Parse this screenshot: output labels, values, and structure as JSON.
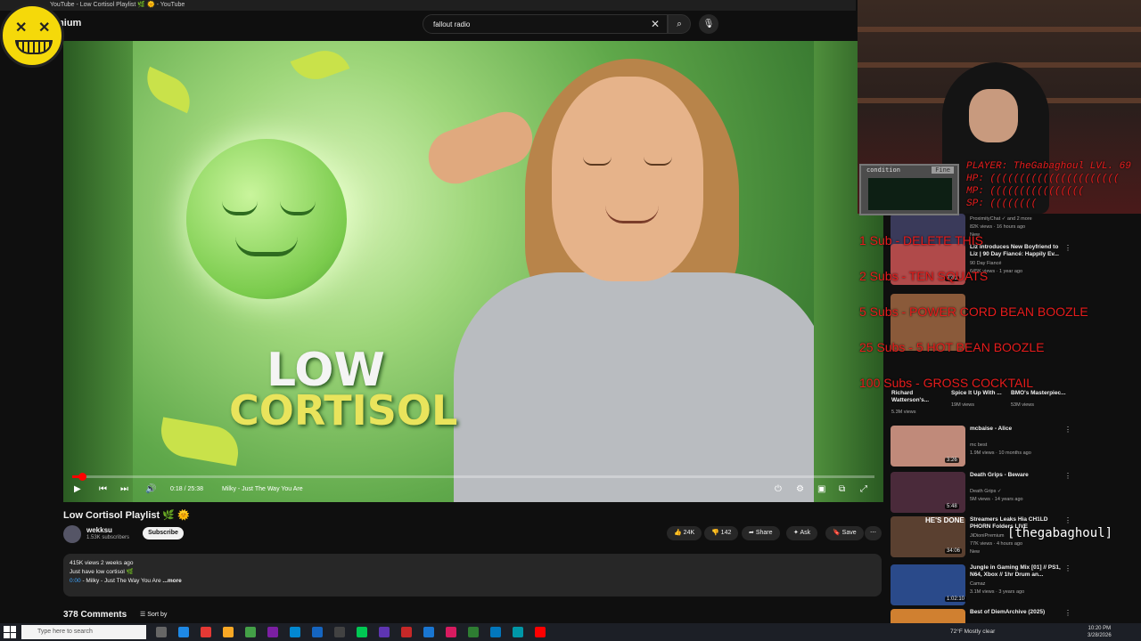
{
  "window": {
    "title": "YouTube - Low Cortisol Playlist 🌿 🌞 - YouTube"
  },
  "header": {
    "brand_partial": "mium"
  },
  "search": {
    "value": "fallout radio"
  },
  "thumbnail": {
    "line1": "LOW",
    "line2": "CORTISOL"
  },
  "player": {
    "time": "0:18 / 25:38",
    "chapter": "Milky - Just The Way You Are",
    "progress": 0.012
  },
  "video": {
    "title": "Low Cortisol Playlist 🌿 🌞",
    "channel": "wekksu",
    "subscribers": "1.53K subscribers",
    "subscribe_label": "Subscribe",
    "likes": "24K",
    "dislikes": "142",
    "share_label": "Share",
    "ask_label": "Ask",
    "save_label": "Save"
  },
  "description": {
    "meta": "415K views  2 weeks ago",
    "line1": "Just have low cortisol 🌿",
    "timestamp": "0:00",
    "line2": " - Milky - Just The Way You Are",
    "more": "...more"
  },
  "comments": {
    "count_label": "378 Comments",
    "sort_label": "Sort by"
  },
  "overlay": {
    "crt_label": "condition",
    "crt_status": "Fine",
    "player_line": "PLAYER: TheGabaghoul LVL. 69",
    "hp_line": "HP: ((((((((((((((((((((((",
    "mp_line": "MP: ((((((((((((((((",
    "sp_line": "SP: ((((((((",
    "goal1": "1 Sub - DELETE THIS",
    "goal2": "2 Subs - TEN SQUATS",
    "goal3": "5 Subs - POWER CORD BEAN BOOZLE",
    "goal4": "25 Subs - 5 HOT BEAN BOOZLE",
    "goal5": "100 Subs - GROSS COCKTAIL",
    "handle": "[thegabaghoul]"
  },
  "sidebar": {
    "recs": [
      {
        "title": "",
        "meta1": "ProximityChat ✓ and 2 more",
        "meta2": "82K views · 16 hours ago",
        "badge": "New",
        "duration": "",
        "color": "#3a3a5a"
      },
      {
        "title": "Liz Introduces New Boyfriend to Liz | 90 Day Fiancé: Happily Ev...",
        "meta1": "90 Day Fiancé",
        "meta2": "645K views · 1 year ago",
        "badge": "",
        "duration": "8:41",
        "color": "#b04a4a"
      },
      {
        "title": "",
        "meta1": "",
        "meta2": "",
        "badge": "",
        "duration": "",
        "color": "#8a5a3a"
      },
      {
        "title": "mcbaise - Alice",
        "meta1": "mc best",
        "meta2": "1.9M views · 10 months ago",
        "badge": "",
        "duration": "3:26",
        "color": "#c08a7a"
      },
      {
        "title": "Death Grips - Beware",
        "meta1": "Death Grips ✓",
        "meta2": "5M views · 14 years ago",
        "badge": "",
        "duration": "5:48",
        "color": "#4a2a3a"
      },
      {
        "title": "Streamers Leaks Hia CH1LD PHORN Folders LIVE",
        "meta1": "JiDioniPremium",
        "meta2": "77K views · 4 hours ago",
        "badge": "New",
        "duration": "34:06",
        "color": "#5a4030"
      },
      {
        "title": "Jungle in Gaming Mix [01] // PS1, N64, Xbox // 1hr Drum an...",
        "meta1": "Camaz",
        "meta2": "3.1M views · 3 years ago",
        "badge": "",
        "duration": "1:02:10",
        "color": "#2a4a8a"
      },
      {
        "title": "Best of DiemArchive (2025)",
        "meta1": "DiEM",
        "meta2": "",
        "badge": "",
        "duration": "",
        "color": "#d08030"
      }
    ],
    "shorts": [
      {
        "title": "Richard Watterson's...",
        "views": "5.3M views"
      },
      {
        "title": "Spice It Up With ...",
        "views": "19M views"
      },
      {
        "title": "BMO's Masterpiec...",
        "views": "53M views"
      }
    ],
    "he_done_label": "HE'S DONE"
  },
  "taskbar": {
    "search_placeholder": "Type here to search",
    "weather": "72°F  Mostly clear",
    "time": "10:20 PM",
    "date": "3/28/2026"
  },
  "colors": {
    "accent_red": "#ff0000",
    "overlay_red": "#e61c1c",
    "bg": "#0f0f0f"
  }
}
